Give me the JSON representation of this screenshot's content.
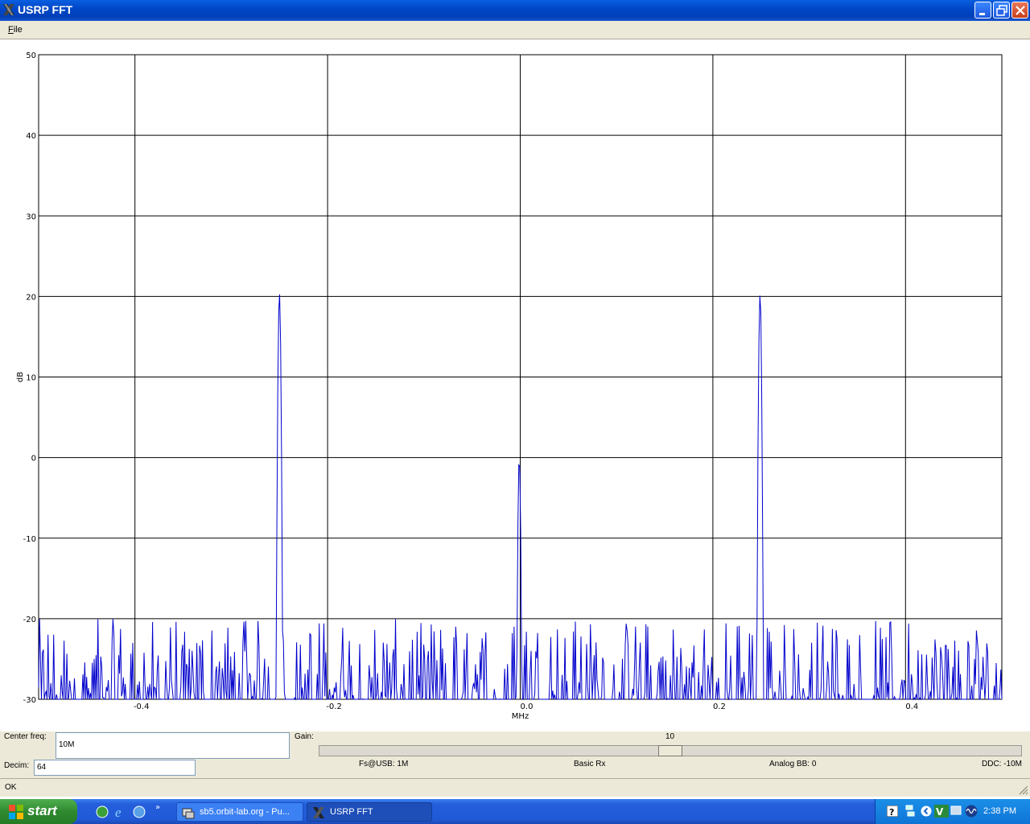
{
  "window": {
    "title": "USRP FFT"
  },
  "menu": {
    "file": "File"
  },
  "chart_data": {
    "type": "line",
    "xlabel": "MHz",
    "ylabel": "dB",
    "xlim": [
      -0.5,
      0.5
    ],
    "ylim": [
      -30,
      50
    ],
    "grid": true,
    "x_ticks": [
      "-0.4",
      "-0.2",
      "0.0",
      "0.2",
      "0.4"
    ],
    "y_ticks": [
      "50",
      "40",
      "30",
      "20",
      "10",
      "0",
      "-10",
      "-20",
      "-30"
    ],
    "series": [
      {
        "color": "#0000cc",
        "peaks": [
          {
            "x": -0.25,
            "y": 20.5
          },
          {
            "x": -0.001,
            "y": 0
          },
          {
            "x": 0.249,
            "y": 20.3
          }
        ],
        "noise_floor": -30,
        "noise_max": -22
      }
    ]
  },
  "controls": {
    "center_freq_label": "Center freq:",
    "center_freq_value": "10M",
    "gain_label": "Gain:",
    "gain_value": "10",
    "gain_level": 0.5,
    "decim_label": "Decim:",
    "decim_value": "64",
    "fs_usb": "Fs@USB: 1M",
    "rx": "Basic Rx",
    "analog_bb": "Analog BB: 0",
    "ddc": "DDC: -10M"
  },
  "status": {
    "text": "OK"
  },
  "taskbar": {
    "start": "start",
    "tasks": [
      "sb5.orbit-lab.org - Pu...",
      "USRP FFT"
    ],
    "clock": "2:38 PM"
  }
}
